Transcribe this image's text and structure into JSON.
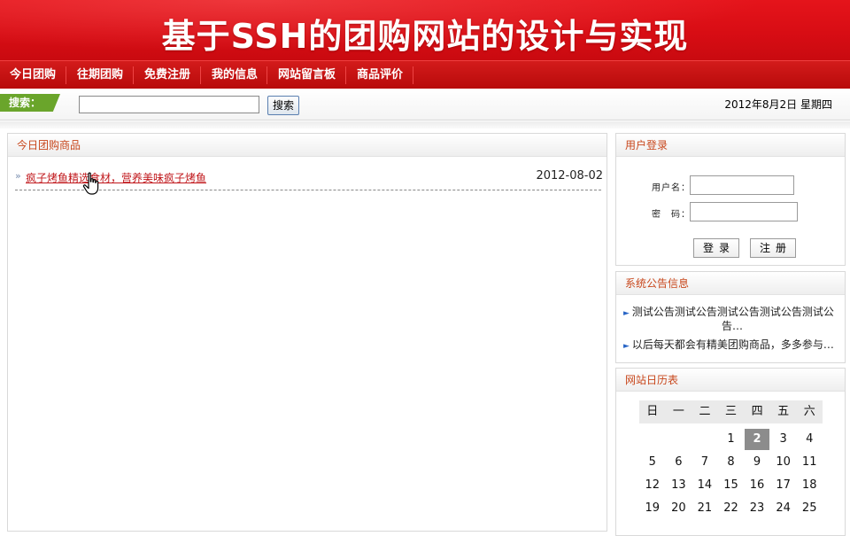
{
  "banner": {
    "title": "基于SSH的团购网站的设计与实现"
  },
  "nav": {
    "items": [
      {
        "label": "今日团购"
      },
      {
        "label": "往期团购"
      },
      {
        "label": "免费注册"
      },
      {
        "label": "我的信息"
      },
      {
        "label": "网站留言板"
      },
      {
        "label": "商品评价"
      }
    ]
  },
  "search": {
    "tag_label": "搜索：",
    "input_value": "",
    "button_label": "搜索",
    "date_text": "2012年8月2日  星期四"
  },
  "main": {
    "panel_title": "今日团购商品",
    "products": [
      {
        "title": "疯子烤鱼精选食材，营养美味疯子烤鱼",
        "date": "2012-08-02"
      }
    ]
  },
  "login": {
    "panel_title": "用户登录",
    "username_label": "用户名：",
    "password_label": "密　码：",
    "username_value": "",
    "password_value": "",
    "login_button": "登录",
    "register_button": "注册"
  },
  "notices": {
    "panel_title": "系统公告信息",
    "items": [
      {
        "line1": "测试公告测试公告测试公告测试公告测试公",
        "line2": "告…"
      },
      {
        "line1": "以后每天都会有精美团购商品，多多参与…"
      }
    ]
  },
  "calendar": {
    "panel_title": "网站日历表",
    "weekdays": [
      "日",
      "一",
      "二",
      "三",
      "四",
      "五",
      "六"
    ],
    "leading_blanks": 3,
    "today": 2,
    "days": [
      1,
      2,
      3,
      4,
      5,
      6,
      7,
      8,
      9,
      10,
      11,
      12,
      13,
      14,
      15,
      16,
      17,
      18,
      19,
      20,
      21,
      22,
      23,
      24,
      25
    ]
  },
  "colors": {
    "brand_red": "#d80d14",
    "nav_red": "#b80b0b",
    "search_tag_green": "#6aa52b",
    "panel_title_orange": "#c8471c",
    "link_red": "#c0171b",
    "today_gray": "#8c8c8c"
  }
}
